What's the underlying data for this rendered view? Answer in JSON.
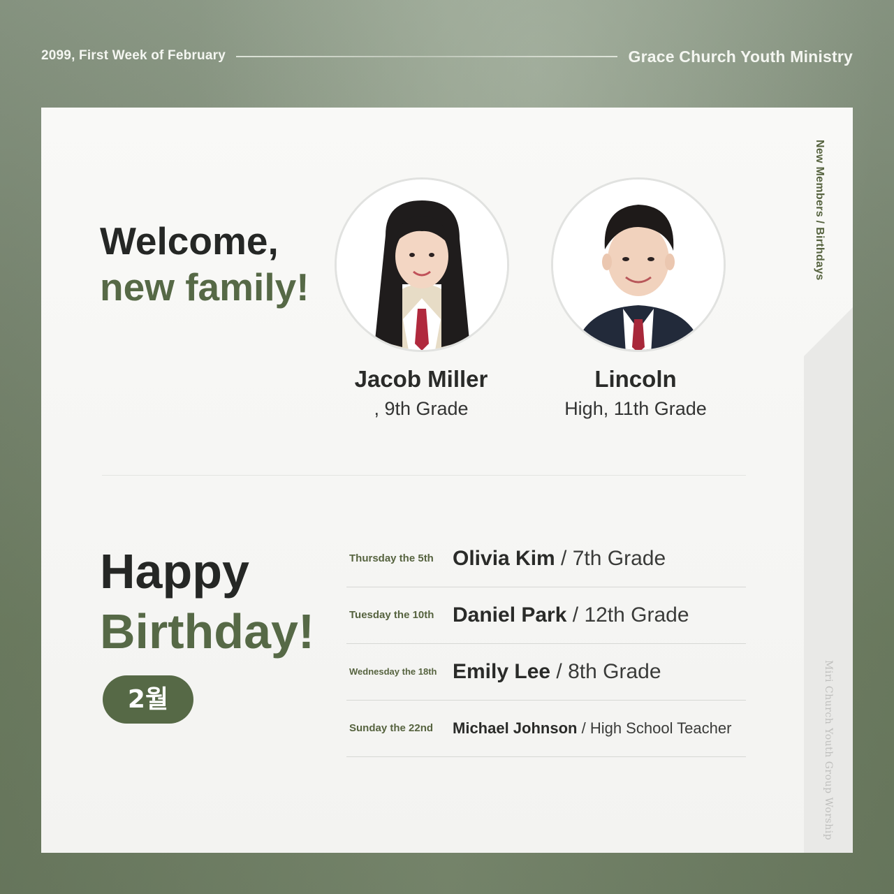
{
  "header": {
    "date": "2099, First Week of February",
    "org": "Grace Church Youth Ministry"
  },
  "side_label": "New Members / Birthdays",
  "footer_watermark": "Miri Church Youth Group Worship",
  "welcome": {
    "line1": "Welcome,",
    "line2": "new family!"
  },
  "members": [
    {
      "name": "Jacob Miller",
      "grade": ", 9th Grade",
      "avatar": "student-photo-girl"
    },
    {
      "name": "Lincoln",
      "grade": "High, 11th Grade",
      "avatar": "student-photo-boy"
    }
  ],
  "birthday": {
    "line1": "Happy",
    "line2": "Birthday!",
    "month": "2월"
  },
  "birthdays": [
    {
      "date": "Thursday the 5th",
      "name": "Olivia Kim",
      "sep": " / ",
      "role": "7th Grade"
    },
    {
      "date": "Tuesday the 10th",
      "name": "Daniel Park",
      "sep": " / ",
      "role": "12th Grade"
    },
    {
      "date": "Wednesday the 18th",
      "name": "Emily Lee",
      "sep": " / ",
      "role": "8th Grade"
    },
    {
      "date": "Sunday the 22nd",
      "name": "Michael Johnson",
      "sep": " / ",
      "role": "High School Teacher"
    }
  ],
  "colors": {
    "accent": "#566946",
    "background": "#7c8a74",
    "card": "#f7f7f5"
  }
}
